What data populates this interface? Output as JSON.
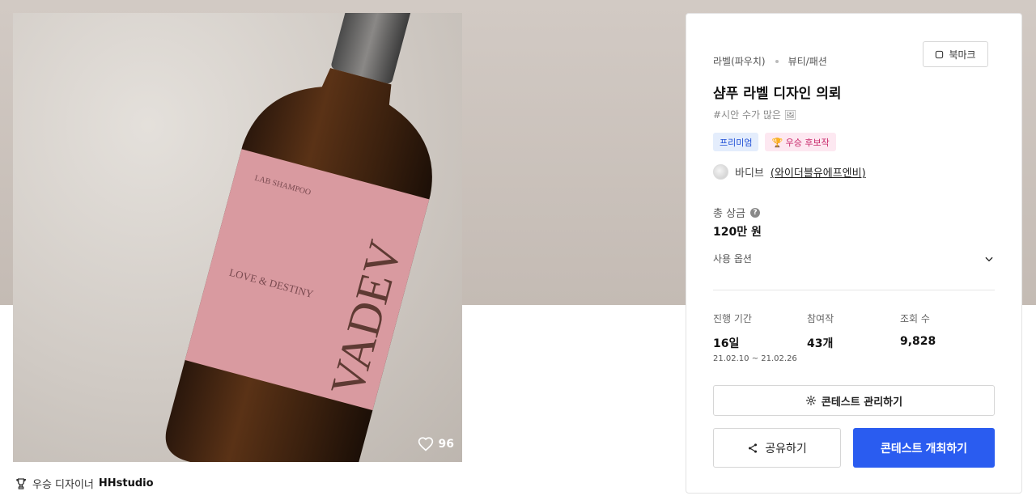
{
  "image": {
    "label_text": {
      "brand_small": "LAB SHAMPOO",
      "product_name": "LOVE & DESTINY",
      "brand_large": "VADEV"
    },
    "likes": "96"
  },
  "winner": {
    "prefix": "우승 디자이너",
    "name": "HHstudio"
  },
  "card": {
    "category": "라벨(파우치)",
    "subcategory": "뷰티/패션",
    "bookmark_label": "북마크",
    "title": "샴푸 라벨 디자인 의뢰",
    "tagline": "#시안 수가 많은 🖼",
    "badges": {
      "premium": "프리미엄",
      "winner_candidate": "🏆 우승 후보작"
    },
    "host": {
      "name": "바디브",
      "company": "(와이더블유에프엔비)"
    },
    "prize": {
      "label": "총 상금",
      "value": "120만 원"
    },
    "usage_label": "사용 옵션",
    "stats": {
      "period_label": "진행 기간",
      "period_value": "16일",
      "period_dates": "21.02.10 ~ 21.02.26",
      "entries_label": "참여작",
      "entries_value": "43개",
      "views_label": "조회 수",
      "views_value": "9,828"
    },
    "manage_label": "콘테스트 관리하기",
    "share_label": "공유하기",
    "host_contest_label": "콘테스트 개최하기"
  },
  "colors": {
    "accent": "#2a5cf0",
    "label_pink": "#d99aa0"
  }
}
